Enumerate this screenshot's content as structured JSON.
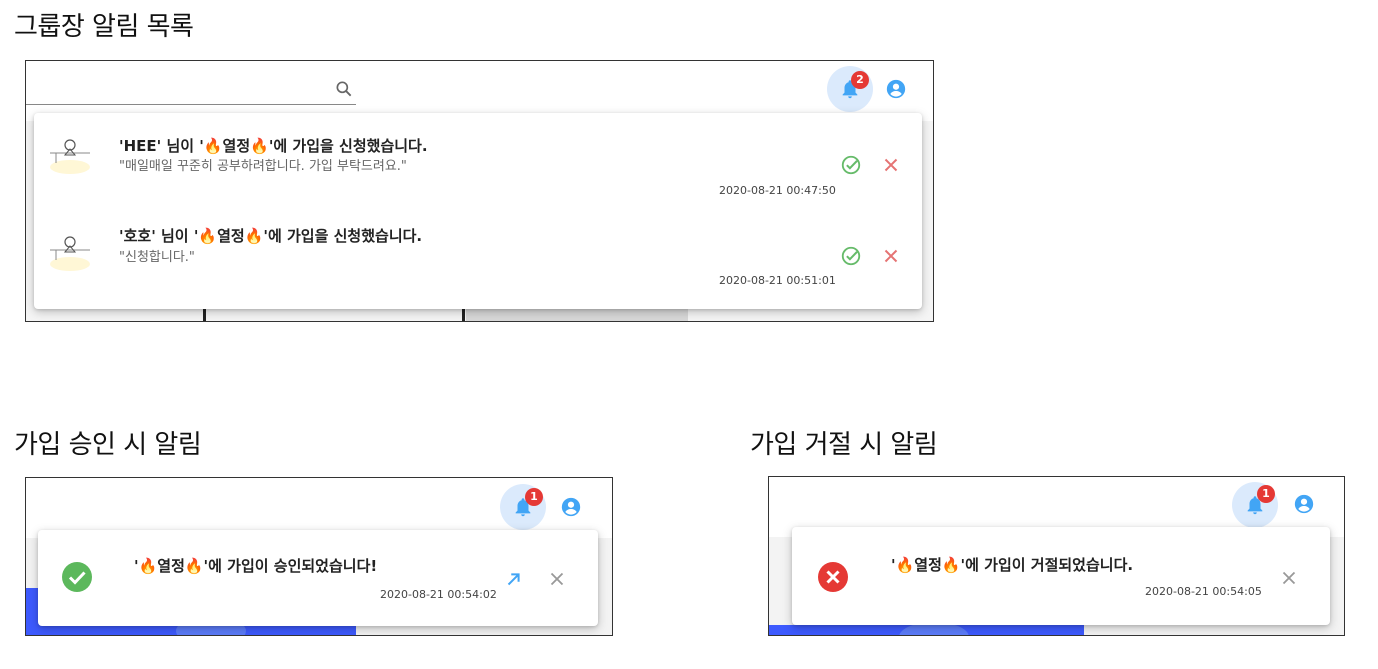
{
  "sections": {
    "list_heading": "그룹장 알림 목록",
    "approve_heading": "가입 승인 시 알림",
    "reject_heading": "가입 거절 시 알림"
  },
  "list_panel": {
    "badge_count": "2",
    "notifications": [
      {
        "title": "'HEE' 님이 '🔥열정🔥'에 가입을 신청했습니다.",
        "message": "\"매일매일 꾸준히 공부하려합니다. 가입 부탁드려요.\"",
        "time": "2020-08-21 00:47:50"
      },
      {
        "title": "'호호' 님이 '🔥열정🔥'에 가입을 신청했습니다.",
        "message": "\"신청합니다.\"",
        "time": "2020-08-21 00:51:01"
      }
    ]
  },
  "approve_panel": {
    "badge_count": "1",
    "title": "'🔥열정🔥'에 가입이 승인되었습니다!",
    "time": "2020-08-21 00:54:02"
  },
  "reject_panel": {
    "badge_count": "1",
    "title": "'🔥열정🔥'에 가입이 거절되었습니다.",
    "time": "2020-08-21 00:54:05"
  },
  "colors": {
    "accept": "#66bb6a",
    "reject": "#e57373",
    "approved_circle": "#5cb85c",
    "rejected_circle": "#e53935",
    "bell": "#42a5f5",
    "badge": "#e53935"
  },
  "icons": {
    "search": "search-icon",
    "bell": "bell-icon",
    "account": "account-circle-icon",
    "accept": "check-circle-outline-icon",
    "reject": "close-icon",
    "open": "arrow-up-right-icon"
  }
}
